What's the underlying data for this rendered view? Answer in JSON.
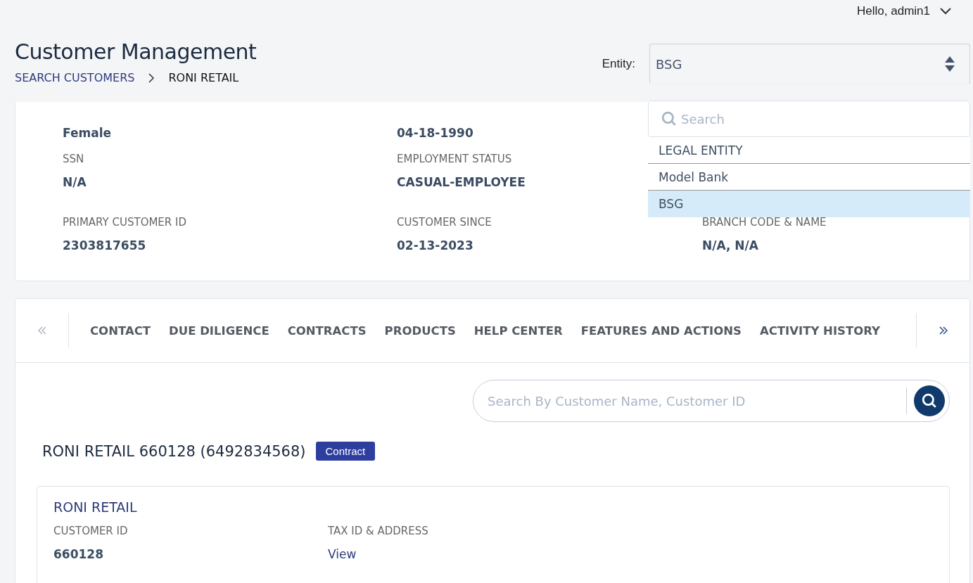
{
  "user_menu": {
    "greeting": "Hello, admin1"
  },
  "page_title": "Customer Management",
  "breadcrumb": [
    "SEARCH CUSTOMERS",
    "RONI RETAIL"
  ],
  "entity_select": {
    "label": "Entity:",
    "value": "BSG",
    "expanded": true,
    "dropdown": {
      "search_placeholder": "Search",
      "items": [
        {
          "kind": "group",
          "label": "LEGAL ENTITY"
        },
        {
          "kind": "option",
          "label": "Model Bank",
          "selected": false
        },
        {
          "kind": "option",
          "label": "BSG",
          "selected": true
        }
      ]
    }
  },
  "customer_details": {
    "columns": [
      [
        {
          "value": "Female"
        },
        {
          "label": "SSN",
          "value": "N/A"
        },
        {
          "label": "PRIMARY CUSTOMER ID",
          "value": "2303817655"
        }
      ],
      [
        {
          "value": "04-18-1990"
        },
        {
          "label": "EMPLOYMENT STATUS",
          "value": "CASUAL-EMPLOYEE"
        },
        {
          "label": "CUSTOMER SINCE",
          "value": "02-13-2023"
        }
      ],
      [
        {
          "label": "BRANCH CODE & NAME",
          "value": "N/A, N/A"
        }
      ]
    ]
  },
  "tabs": [
    "CONTACT",
    "DUE DILIGENCE",
    "CONTRACTS",
    "PRODUCTS",
    "HELP CENTER",
    "FEATURES AND ACTIONS",
    "ACTIVITY HISTORY"
  ],
  "customer_search": {
    "placeholder": "Search By Customer Name, Customer ID"
  },
  "contract_heading": {
    "title": "RONI RETAIL 660128 (6492834568)",
    "badge": "Contract"
  },
  "contract_card": {
    "name": "RONI RETAIL",
    "fields": [
      {
        "label": "CUSTOMER ID",
        "value": "660128",
        "kind": "text"
      },
      {
        "label": "TAX ID & ADDRESS",
        "value": "View",
        "kind": "link"
      }
    ]
  }
}
